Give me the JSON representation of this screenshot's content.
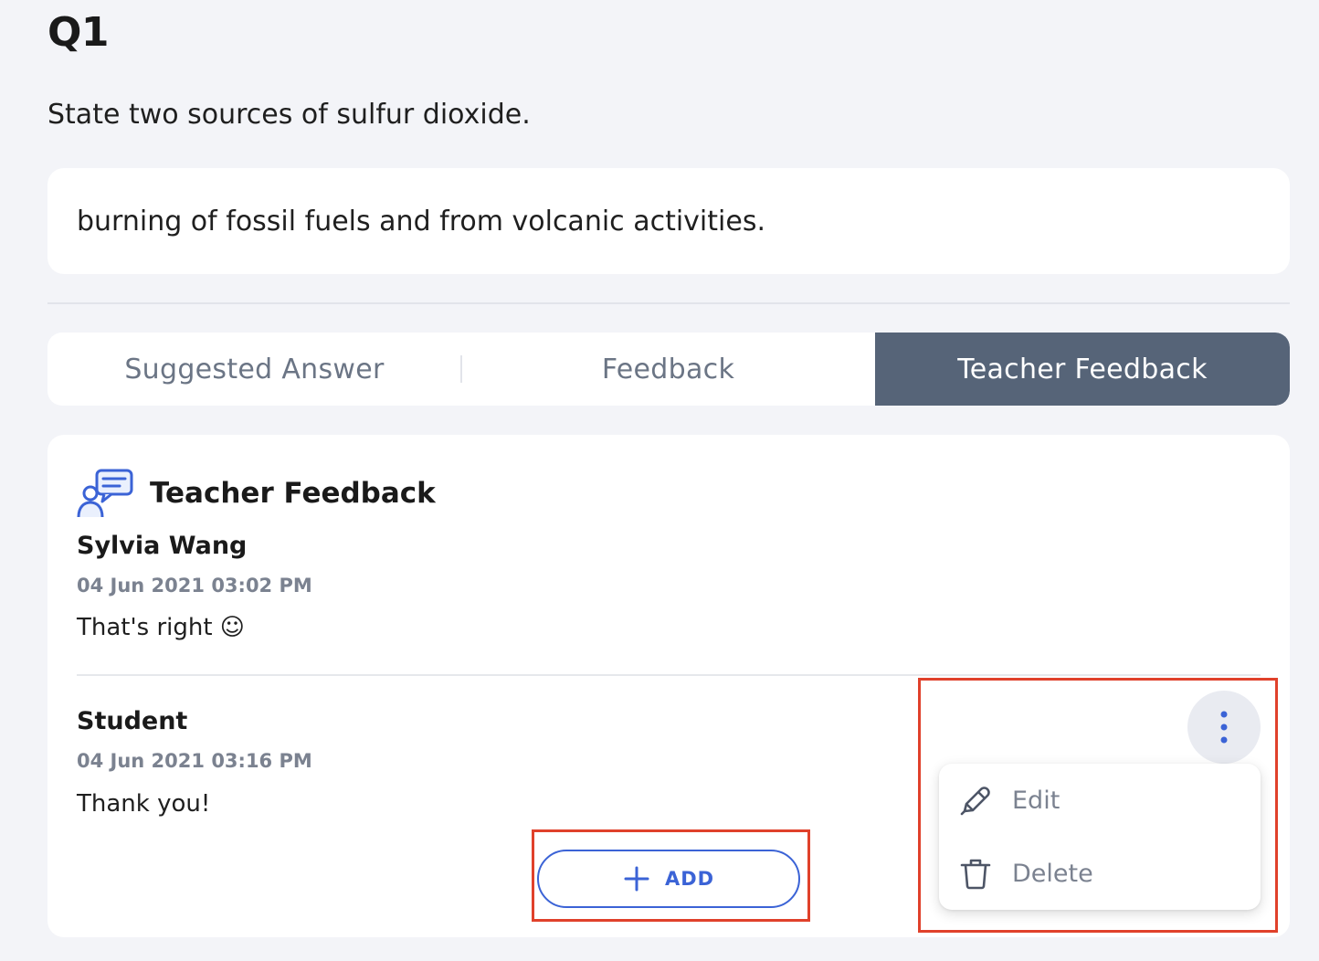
{
  "question": {
    "number": "Q1",
    "prompt": "State two sources of sulfur dioxide.",
    "answer": "burning of fossil fuels and from volcanic activities."
  },
  "tabs": [
    {
      "label": "Suggested Answer",
      "active": false
    },
    {
      "label": "Feedback",
      "active": false
    },
    {
      "label": "Teacher Feedback",
      "active": true
    }
  ],
  "feedback_panel": {
    "title": "Teacher Feedback",
    "icon": "chat-teacher-icon",
    "entries": [
      {
        "name": "Sylvia Wang",
        "timestamp": "04 Jun 2021 03:02 PM",
        "message": "That's right ☺"
      },
      {
        "name": "Student",
        "timestamp": "04 Jun 2021 03:16 PM",
        "message": "Thank you!"
      }
    ],
    "add_button_label": "ADD",
    "more_icon": "kebab-menu-icon",
    "menu": [
      {
        "label": "Edit",
        "icon": "pencil-icon"
      },
      {
        "label": "Delete",
        "icon": "trash-icon"
      }
    ]
  },
  "colors": {
    "background": "#f3f4f8",
    "active_tab": "#566478",
    "accent": "#3b63d6",
    "highlight": "#e0412b"
  }
}
